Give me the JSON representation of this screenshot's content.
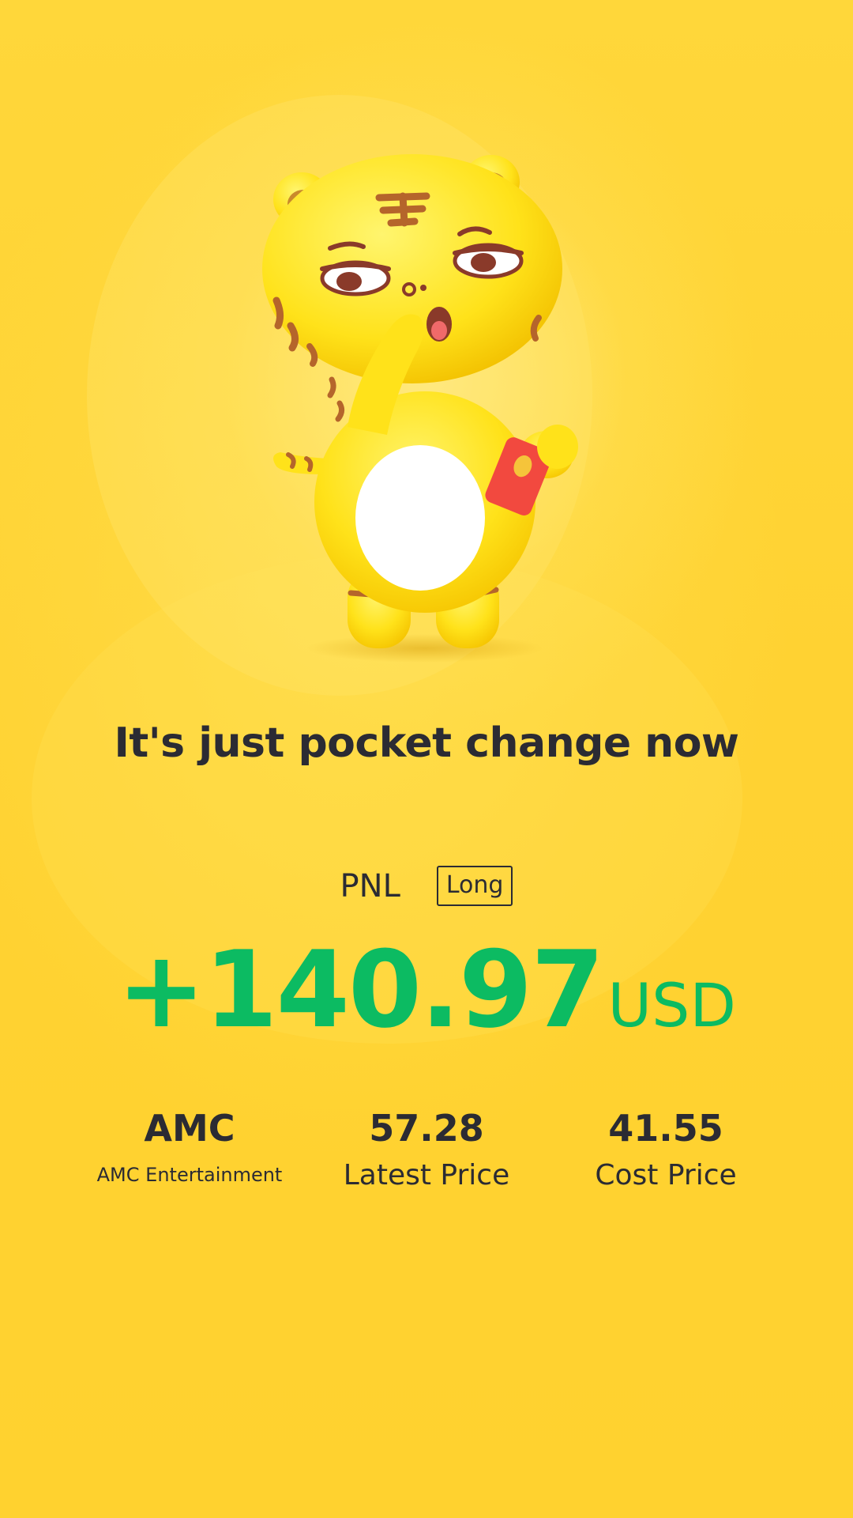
{
  "mascot": {
    "icon": "tiger-mascot-icon",
    "envelope_icon": "red-envelope-icon"
  },
  "headline": "It's just pocket change now",
  "pnl": {
    "label": "PNL",
    "direction_badge": "Long",
    "amount": "+140.97",
    "currency": "USD",
    "color": "#0cbb62"
  },
  "stats": {
    "symbol": "AMC",
    "company_name": "AMC Entertainment",
    "latest_price": "57.28",
    "latest_price_label": "Latest Price",
    "cost_price": "41.55",
    "cost_price_label": "Cost Price"
  },
  "theme": {
    "background": "#ffd42e",
    "text": "#2b2b33"
  }
}
